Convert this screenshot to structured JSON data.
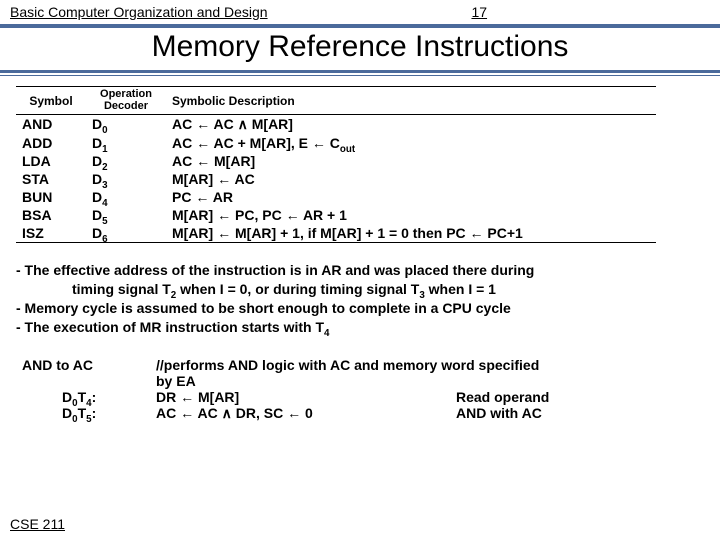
{
  "header": {
    "course": "Basic Computer Organization and Design",
    "page": "17"
  },
  "title": "Memory Reference Instructions",
  "table": {
    "head": {
      "symbol": "Symbol",
      "op": "Operation\nDecoder",
      "desc": "Symbolic Description"
    },
    "rows": [
      {
        "sym": "AND",
        "op": "D",
        "opn": "0",
        "desc": "AC ← AC ∧ M[AR]"
      },
      {
        "sym": "ADD",
        "op": "D",
        "opn": "1",
        "desc": "AC ← AC + M[AR], E ← C",
        "descsub": "out"
      },
      {
        "sym": "LDA",
        "op": "D",
        "opn": "2",
        "desc": "AC ← M[AR]"
      },
      {
        "sym": "STA",
        "op": "D",
        "opn": "3",
        "desc": "M[AR] ←  AC"
      },
      {
        "sym": "BUN",
        "op": "D",
        "opn": "4",
        "desc": "PC ← AR"
      },
      {
        "sym": "BSA",
        "op": "D",
        "opn": "5",
        "desc": "M[AR] ← PC, PC ← AR + 1"
      },
      {
        "sym": "ISZ",
        "op": "D",
        "opn": "6",
        "desc": "M[AR] ← M[AR] + 1, if M[AR] + 1 = 0 then PC ← PC+1"
      }
    ]
  },
  "notes": {
    "l1a": "- The effective address of the instruction is in AR and was placed there during",
    "l1b": "timing signal T",
    "l1b_sub1": "2",
    "l1c": " when I = 0, or during timing signal T",
    "l1c_sub": "3",
    "l1d": " when I = 1",
    "l2": "- Memory cycle is assumed to be short enough to complete in a CPU cycle",
    "l3a": "- The execution of MR instruction starts with T",
    "l3_sub": "4"
  },
  "and": {
    "title": "AND to AC",
    "comment": "//performs AND logic with AC and memory word specified by EA",
    "r1": {
      "label_pre": "D",
      "label_s1": "0",
      "label_mid": "T",
      "label_s2": "4",
      "label_post": ":",
      "op": "DR ← M[AR]",
      "note": "Read operand"
    },
    "r2": {
      "label_pre": "D",
      "label_s1": "0",
      "label_mid": "T",
      "label_s2": "5",
      "label_post": ":",
      "op": "AC ← AC ∧ DR, SC ← 0",
      "note": "AND with AC"
    }
  },
  "footer": "CSE 211"
}
